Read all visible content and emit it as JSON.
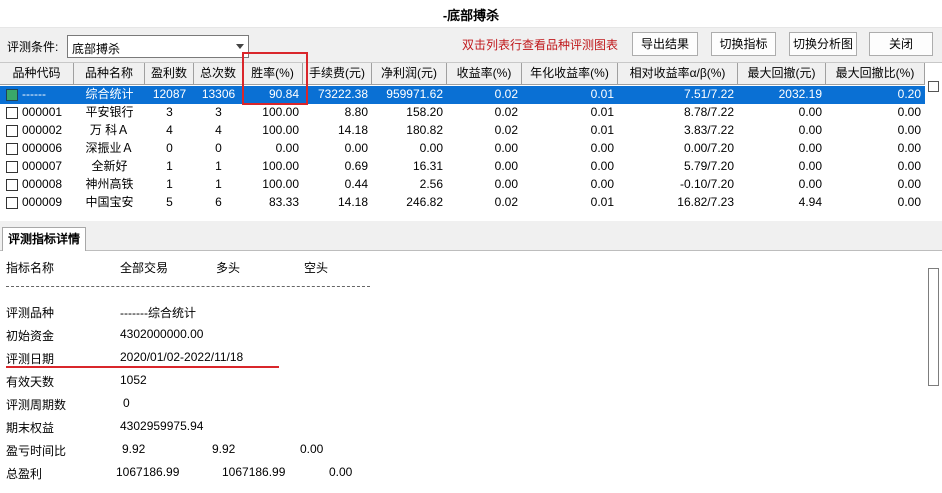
{
  "window": {
    "title": "-底部搏杀"
  },
  "toolbar": {
    "condition_label": "评测条件:",
    "condition_value": "底部搏杀",
    "hint": "双击列表行查看品种评测图表",
    "export_label": "导出结果",
    "switch_metric_label": "切换指标",
    "switch_chart_label": "切换分析图",
    "close_label": "关闭"
  },
  "table": {
    "columns": [
      "品种代码",
      "品种名称",
      "盈利数",
      "总次数",
      "胜率(%)",
      "手续费(元)",
      "净利润(元)",
      "收益率(%)",
      "年化收益率(%)",
      "相对收益率α/β(%)",
      "最大回撤(元)",
      "最大回撤比(%)"
    ],
    "rows": [
      [
        "------",
        "综合统计",
        "12087",
        "13306",
        "90.84",
        "73222.38",
        "959971.62",
        "0.02",
        "0.01",
        "7.51/7.22",
        "2032.19",
        "0.20"
      ],
      [
        "000001",
        "平安银行",
        "3",
        "3",
        "100.00",
        "8.80",
        "158.20",
        "0.02",
        "0.01",
        "8.78/7.22",
        "0.00",
        "0.00"
      ],
      [
        "000002",
        "万 科Ａ",
        "4",
        "4",
        "100.00",
        "14.18",
        "180.82",
        "0.02",
        "0.01",
        "3.83/7.22",
        "0.00",
        "0.00"
      ],
      [
        "000006",
        "深振业Ａ",
        "0",
        "0",
        "0.00",
        "0.00",
        "0.00",
        "0.00",
        "0.00",
        "0.00/7.20",
        "0.00",
        "0.00"
      ],
      [
        "000007",
        "全新好",
        "1",
        "1",
        "100.00",
        "0.69",
        "16.31",
        "0.00",
        "0.00",
        "5.79/7.20",
        "0.00",
        "0.00"
      ],
      [
        "000008",
        "神州高铁",
        "1",
        "1",
        "100.00",
        "0.44",
        "2.56",
        "0.00",
        "0.00",
        "-0.10/7.20",
        "0.00",
        "0.00"
      ],
      [
        "000009",
        "中国宝安",
        "5",
        "6",
        "83.33",
        "14.18",
        "246.82",
        "0.02",
        "0.01",
        "16.82/7.23",
        "4.94",
        "0.00"
      ]
    ]
  },
  "detail": {
    "tab_label": "评测指标详情",
    "headers": [
      "指标名称",
      "全部交易",
      "多头",
      "空头"
    ],
    "dashes": "-----------------------------------------------------------------------------------------------",
    "items": [
      {
        "label": "评测品种",
        "v1": "-------综合统计"
      },
      {
        "label": "初始资金",
        "v1": "4302000000.00"
      },
      {
        "label": "评测日期",
        "v1": "2020/01/02-2022/11/18"
      },
      {
        "label": "有效天数",
        "v1": "1052"
      },
      {
        "label": "评测周期数",
        "v1": "0"
      },
      {
        "label": "期末权益",
        "v1": "4302959975.94"
      },
      {
        "label": "盈亏时间比",
        "v1": "9.92",
        "v2": "9.92",
        "v3": "0.00"
      },
      {
        "label": "总盈利",
        "v1": "1067186.99",
        "v2": "1067186.99",
        "v3": "0.00"
      }
    ]
  }
}
